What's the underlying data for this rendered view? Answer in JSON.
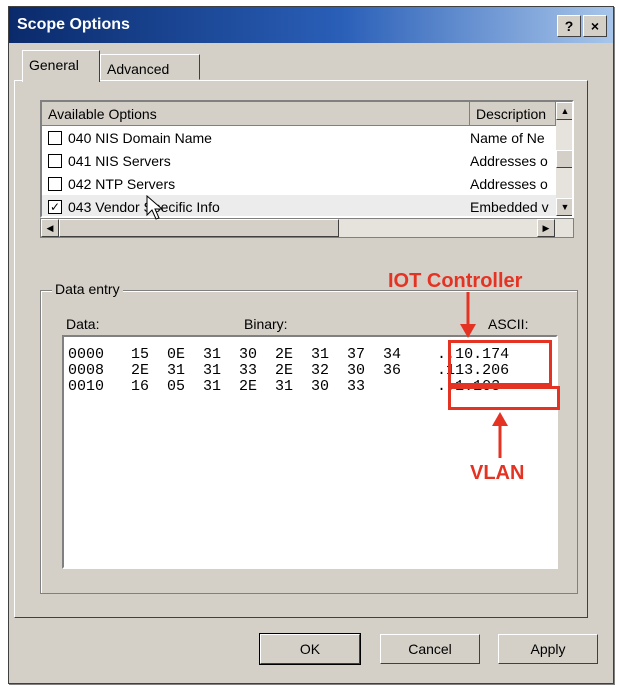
{
  "window": {
    "title": "Scope Options",
    "help_label": "?",
    "close_label": "×"
  },
  "tabs": [
    {
      "label": "General"
    },
    {
      "label": "Advanced"
    }
  ],
  "options_list": {
    "col_option": "Available Options",
    "col_desc": "Description",
    "rows": [
      {
        "checked": false,
        "name": "040 NIS Domain Name",
        "desc": "Name of Ne"
      },
      {
        "checked": false,
        "name": "041 NIS Servers",
        "desc": "Addresses o"
      },
      {
        "checked": false,
        "name": "042 NTP Servers",
        "desc": "Addresses o"
      },
      {
        "checked": true,
        "name": "043 Vendor Specific Info",
        "desc": "Embedded v"
      }
    ]
  },
  "data_entry": {
    "group_label": "Data entry",
    "data_label": "Data:",
    "binary_label": "Binary:",
    "ascii_label": "ASCII:",
    "lines": [
      "0000   15  0E  31  30  2E  31  37  34    ..10.174",
      "0008   2E  31  31  33  2E  32  30  36    .113.206",
      "0010   16  05  31  2E  31  30  33        ..1.103"
    ]
  },
  "annotations": {
    "iot_controller": "IOT Controller",
    "vlan": "VLAN",
    "color": "#e53323"
  },
  "buttons": {
    "ok": "OK",
    "cancel": "Cancel",
    "apply": "Apply"
  }
}
